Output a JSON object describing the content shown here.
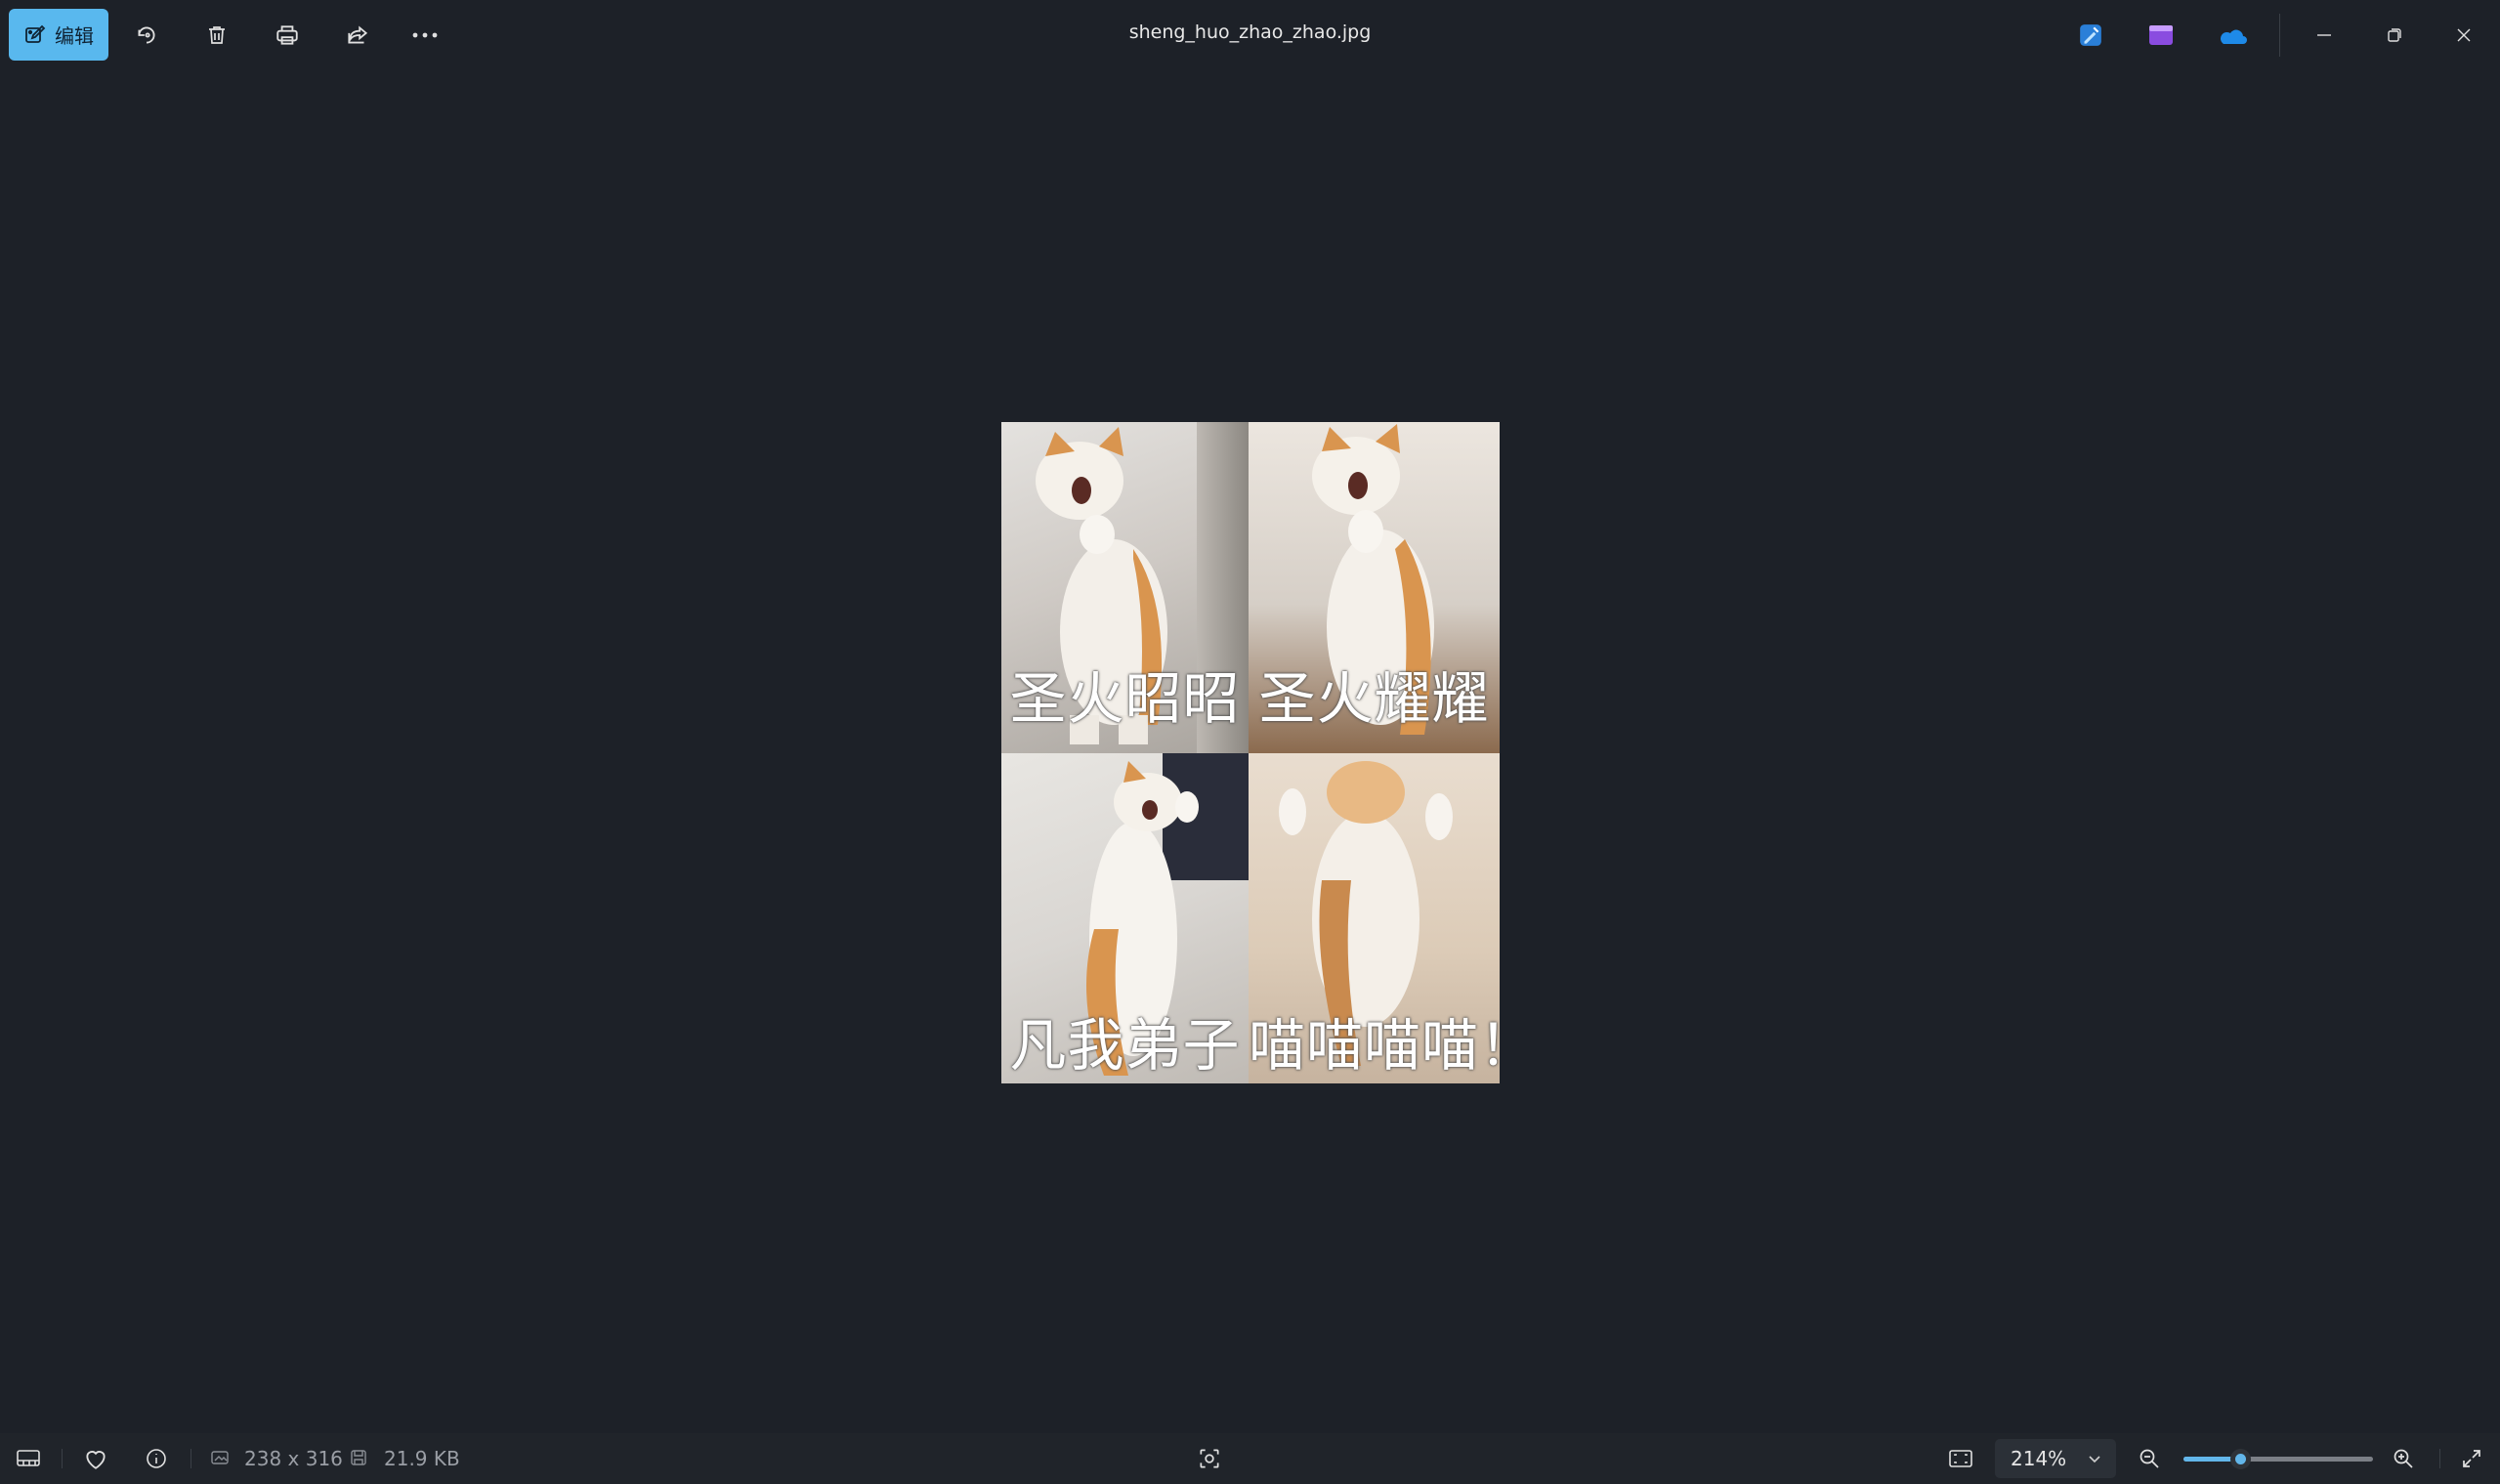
{
  "toolbar": {
    "edit_label": "编辑",
    "icons": [
      "edit-icon",
      "rotate-icon",
      "delete-icon",
      "print-icon",
      "share-icon",
      "more-icon"
    ]
  },
  "window": {
    "title": "sheng_huo_zhao_zhao.jpg",
    "app_icons": [
      "designer-app-icon",
      "clipchamp-icon",
      "onedrive-icon"
    ],
    "controls": [
      "minimize-icon",
      "restore-icon",
      "close-icon"
    ]
  },
  "image": {
    "captions": [
      "圣火昭昭",
      "圣火耀耀",
      "凡我弟子",
      "喵喵喵喵！"
    ]
  },
  "status": {
    "dimensions": "238 x 316",
    "file_size": "21.9 KB",
    "zoom": "214%",
    "zoom_level": 0.3
  },
  "colors": {
    "accent": "#59b8ee",
    "background": "#1d2128"
  }
}
